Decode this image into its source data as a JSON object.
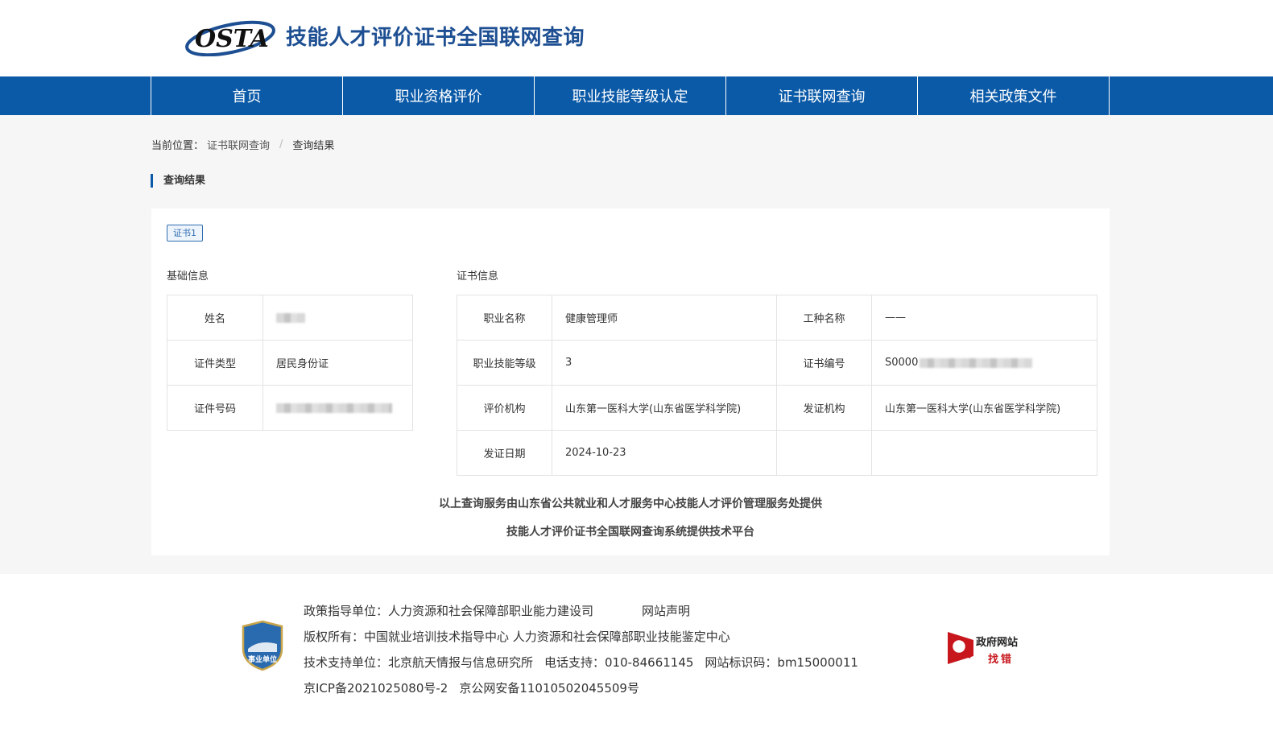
{
  "header": {
    "logo_text": "OSTA",
    "title": "技能人才评价证书全国联网查询"
  },
  "nav": [
    "首页",
    "职业资格评价",
    "职业技能等级认定",
    "证书联网查询",
    "相关政策文件"
  ],
  "breadcrumb": {
    "prefix": "当前位置：",
    "link": "证书联网查询",
    "separator": "/",
    "current": "查询结果"
  },
  "section_title": "查询结果",
  "cert_tab": "证书1",
  "basic": {
    "heading": "基础信息",
    "rows": [
      {
        "label": "姓名",
        "value": ""
      },
      {
        "label": "证件类型",
        "value": "居民身份证"
      },
      {
        "label": "证件号码",
        "value": ""
      }
    ]
  },
  "cert": {
    "heading": "证书信息",
    "rows": [
      {
        "label1": "职业名称",
        "value1": "健康管理师",
        "label2": "工种名称",
        "value2": "——"
      },
      {
        "label1": "职业技能等级",
        "value1": "3",
        "label2": "证书编号",
        "value2": "S0000"
      },
      {
        "label1": "评价机构",
        "value1": "山东第一医科大学(山东省医学科学院)",
        "label2": "发证机构",
        "value2": "山东第一医科大学(山东省医学科学院)"
      },
      {
        "label1": "发证日期",
        "value1": "2024-10-23",
        "label2": "",
        "value2": ""
      }
    ]
  },
  "notes": {
    "line1": "以上查询服务由山东省公共就业和人才服务中心技能人才评价管理服务处提供",
    "line2": "技能人才评价证书全国联网查询系统提供技术平台"
  },
  "footer": {
    "badge_text": "事业单位",
    "line1_a": "政策指导单位：人力资源和社会保障部职业能力建设司",
    "line1_b": "网站声明",
    "line2": "版权所有：中国就业培训技术指导中心   人力资源和社会保障部职业技能鉴定中心",
    "line3_a": "技术支持单位：北京航天情报与信息研究所",
    "line3_b": "电话支持：010-84661145",
    "line3_c": "网站标识码：bm15000011",
    "line4_a": "京ICP备2021025080号-2",
    "line4_b": "京公网安备11010502045509号",
    "gov_text1": "政府网站",
    "gov_text2": "找错"
  },
  "colors": {
    "nav_bg": "#0b5aa8",
    "title": "#1d4f92",
    "gov_red": "#c8161d"
  }
}
